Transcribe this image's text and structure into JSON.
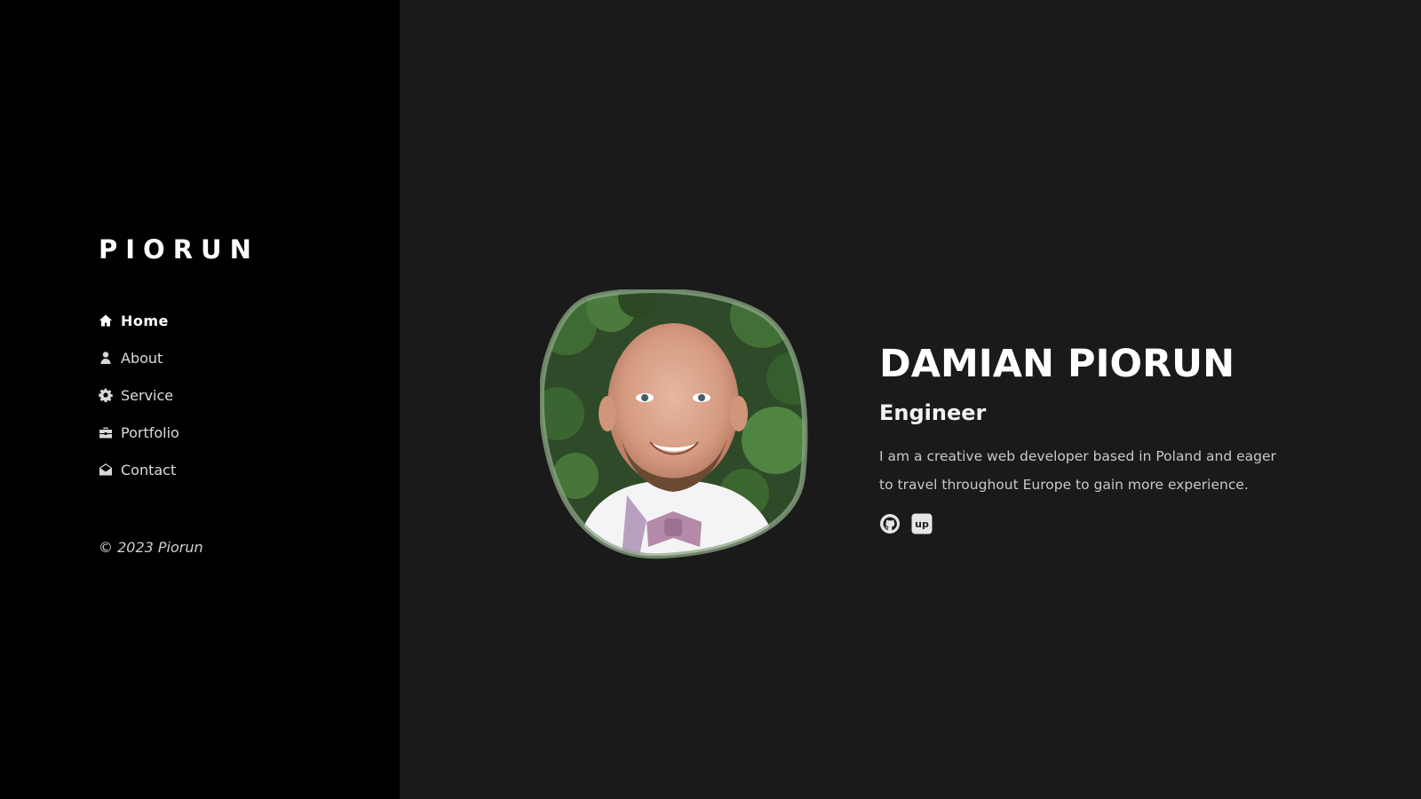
{
  "sidebar": {
    "logo": "PIORUN",
    "nav": [
      {
        "label": "Home",
        "icon": "home-icon",
        "active": true
      },
      {
        "label": "About",
        "icon": "user-icon",
        "active": false
      },
      {
        "label": "Service",
        "icon": "gear-icon",
        "active": false
      },
      {
        "label": "Portfolio",
        "icon": "briefcase-icon",
        "active": false
      },
      {
        "label": "Contact",
        "icon": "envelope-open-icon",
        "active": false
      }
    ],
    "copyright": "© 2023 Piorun"
  },
  "hero": {
    "name": "DAMIAN PIORUN",
    "title": "Engineer",
    "description": "I am a creative web developer based in Poland and eager to travel throughout Europe to gain more experience.",
    "social": [
      {
        "icon": "github-icon"
      },
      {
        "icon": "upwork-icon",
        "text": "up"
      }
    ]
  },
  "colors": {
    "sidebar_bg": "#000000",
    "main_bg": "#1a1a1a",
    "text_primary": "#ffffff",
    "text_secondary": "#c9c9c9"
  }
}
